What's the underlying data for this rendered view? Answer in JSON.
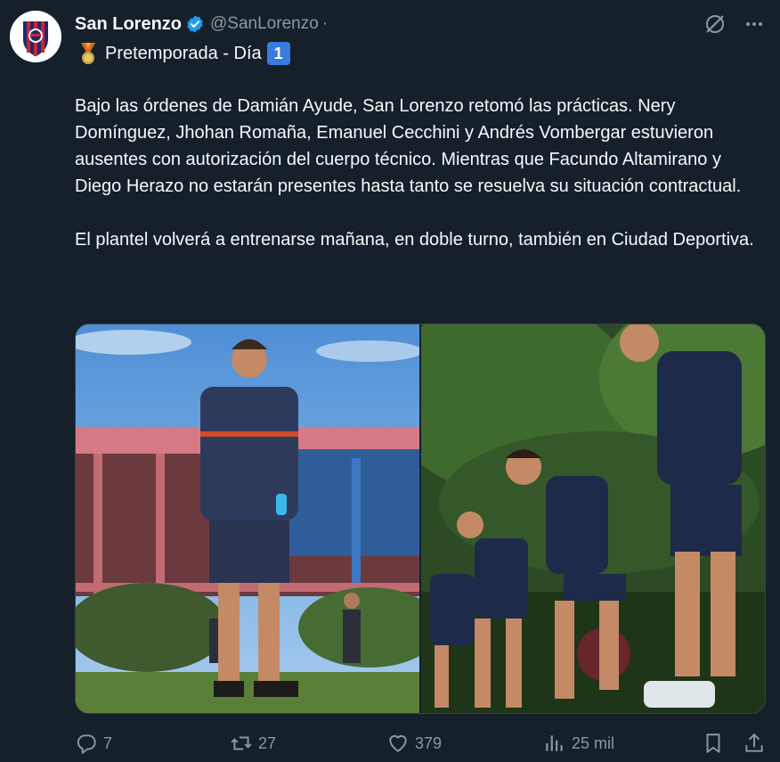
{
  "account": {
    "name": "San Lorenzo",
    "handle": "@SanLorenzo",
    "separator": "·",
    "verified": true,
    "verified_color": "#1d9bf0"
  },
  "tweet": {
    "subtitle": "Pretemporada - Día",
    "subtitle_number": "1",
    "paragraphs": [
      "Bajo las órdenes de Damián Ayude, San Lorenzo retomó las prácticas. Nery Domínguez, Jhohan Romaña, Emanuel Cecchini y Andrés Vombergar estuvieron ausentes con autorización del cuerpo técnico. Mientras que Facundo Altamirano y Diego Herazo no estarán presentes hasta tanto se resuelva su situación contractual.",
      "El plantel volverá a entrenarse mañana, en doble turno, también en Ciudad Deportiva."
    ]
  },
  "media": {
    "photos": [
      {
        "name": "training-photo-coach"
      },
      {
        "name": "training-photo-players"
      }
    ]
  },
  "actions": {
    "replies": "7",
    "retweets": "27",
    "likes": "379",
    "views": "25 mil"
  },
  "icons": {
    "reply": "reply-icon",
    "retweet": "retweet-icon",
    "like": "heart-icon",
    "views": "views-icon",
    "bookmark": "bookmark-icon",
    "share": "share-icon",
    "grok": "grok-icon",
    "more": "more-icon",
    "medal": "medal-icon"
  },
  "colors": {
    "background": "#15202b",
    "text": "#f7f9f9",
    "muted": "#8b98a5",
    "club_red": "#d3202f",
    "club_blue": "#1b2a6b"
  }
}
